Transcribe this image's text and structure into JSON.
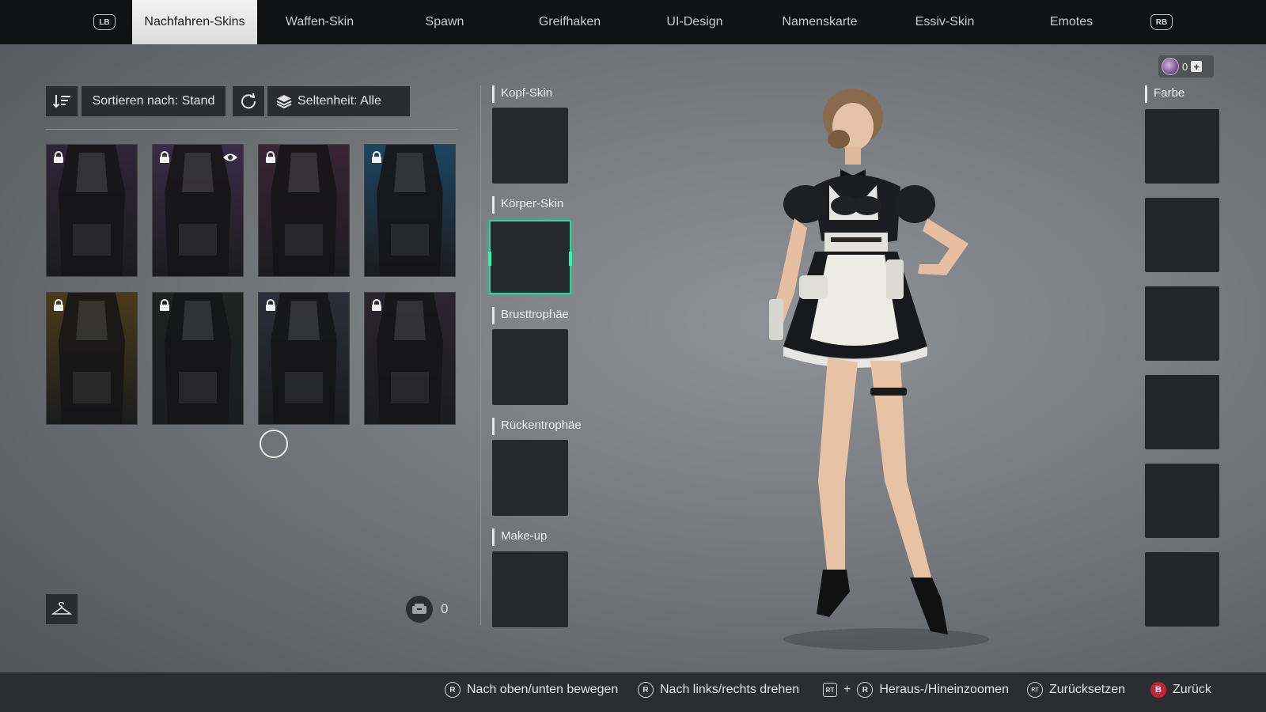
{
  "topbar": {
    "left_bumper": "LB",
    "right_bumper": "RB",
    "tabs": [
      {
        "label": "Nachfahren-Skins",
        "active": true
      },
      {
        "label": "Waffen-Skin",
        "active": false
      },
      {
        "label": "Spawn",
        "active": false
      },
      {
        "label": "Greifhaken",
        "active": false
      },
      {
        "label": "UI-Design",
        "active": false
      },
      {
        "label": "Namenskarte",
        "active": false
      },
      {
        "label": "Essiv-Skin",
        "active": false
      },
      {
        "label": "Emotes",
        "active": false
      }
    ]
  },
  "currency": {
    "amount": "0",
    "icon": "caliber-coin-icon"
  },
  "filters": {
    "sort_label": "Sortieren nach: Stand",
    "rarity_label": "Seltenheit: Alle"
  },
  "skins": [
    {
      "name": "dark-uniform",
      "locked": true,
      "bg": "#2f2538"
    },
    {
      "name": "maid-outfit",
      "locked": true,
      "preview": true,
      "bg": "#3a2c46"
    },
    {
      "name": "red-leather",
      "locked": true,
      "bg": "#3a2436"
    },
    {
      "name": "blue-hoodie",
      "locked": true,
      "bg": "#1d4560"
    },
    {
      "name": "panda-yellow",
      "locked": true,
      "bg": "#4a3a1a"
    },
    {
      "name": "black-green-armor",
      "locked": true,
      "bg": "#1e2320"
    },
    {
      "name": "blue-white-dress",
      "locked": true,
      "bg": "#2a2e38"
    },
    {
      "name": "black-purple-armor",
      "locked": true,
      "bg": "#2a2430"
    }
  ],
  "inventory": {
    "ticket_count": "0"
  },
  "slots": [
    {
      "label": "Kopf-Skin"
    },
    {
      "label": "Körper-Skin",
      "selected": true
    },
    {
      "label": "Brusttrophäe"
    },
    {
      "label": "Rückentrophäe"
    },
    {
      "label": "Make-up"
    }
  ],
  "colors": {
    "label": "Farbe",
    "count": 6
  },
  "hints": [
    {
      "button": "R",
      "label": "Nach oben/unten bewegen"
    },
    {
      "button": "R",
      "label": "Nach links/rechts drehen"
    },
    {
      "button": "RT",
      "plus": "+",
      "button2": "R",
      "label": "Heraus-/Hineinzoomen"
    },
    {
      "button": "RT",
      "label": "Zurücksetzen"
    },
    {
      "button": "B",
      "label": "Zurück"
    }
  ],
  "accent_color": "#2ad39b"
}
